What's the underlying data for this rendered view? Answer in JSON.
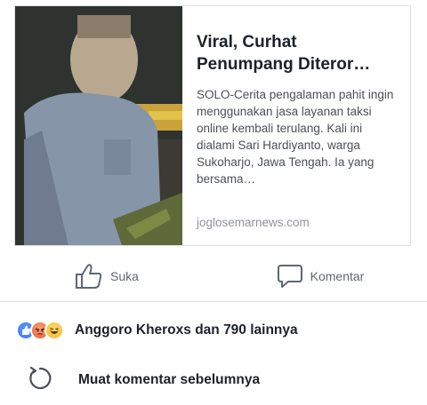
{
  "link_preview": {
    "title": "Viral, Curhat Penumpang Diteror…",
    "description": "SOLO-Cerita pengalaman pahit ingin menggunakan jasa layanan taksi online kembali terulang. Kali ini dialami Sari Hardiyanto, warga Sukoharjo, Jawa Tengah. Ia yang bersama…",
    "domain": "joglosemarnews.com"
  },
  "actions": {
    "like_label": "Suka",
    "comment_label": "Komentar"
  },
  "reactions": {
    "icons": [
      "like-icon",
      "angry-icon",
      "haha-icon"
    ],
    "summary": "Anggoro Kheroxs dan 790 lainnya"
  },
  "comments": {
    "load_previous_label": "Muat komentar sebelumnya"
  },
  "colors": {
    "like_blue": "#3b7cf4",
    "angry_orange": "#f5764a",
    "haha_yellow": "#f7c843"
  }
}
